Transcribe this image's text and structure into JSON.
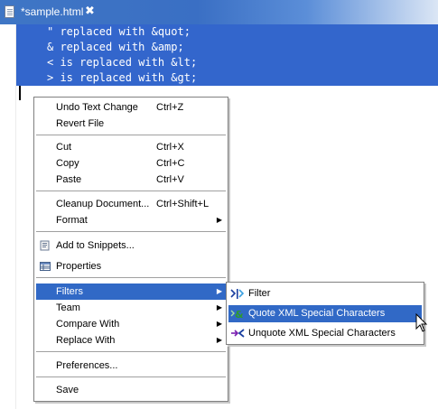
{
  "tab": {
    "title": "*sample.html",
    "close_glyph": "✖"
  },
  "editor": {
    "lines": [
      "\" replaced with &quot;",
      "& replaced with &amp;",
      "< is replaced with &lt;",
      "> is replaced with &gt;"
    ],
    "selection_color": "#3366cc"
  },
  "context_menu": {
    "undo": {
      "label": "Undo Text Change",
      "accel": "Ctrl+Z"
    },
    "revert": {
      "label": "Revert File"
    },
    "cut": {
      "label": "Cut",
      "accel": "Ctrl+X"
    },
    "copy": {
      "label": "Copy",
      "accel": "Ctrl+C"
    },
    "paste": {
      "label": "Paste",
      "accel": "Ctrl+V"
    },
    "cleanup": {
      "label": "Cleanup Document...",
      "accel": "Ctrl+Shift+L"
    },
    "format": {
      "label": "Format"
    },
    "add_snippets": {
      "label": "Add to Snippets..."
    },
    "properties": {
      "label": "Properties"
    },
    "filters": {
      "label": "Filters"
    },
    "team": {
      "label": "Team"
    },
    "compare": {
      "label": "Compare With"
    },
    "replace": {
      "label": "Replace With"
    },
    "preferences": {
      "label": "Preferences..."
    },
    "save": {
      "label": "Save"
    },
    "highlight_color": "#3169c6"
  },
  "filters_submenu": {
    "filter": {
      "label": "Filter",
      "icon": "filter-icon"
    },
    "quote": {
      "label": "Quote XML Special Characters",
      "icon": "quote-xml-icon"
    },
    "unquote": {
      "label": "Unquote XML Special Characters",
      "icon": "unquote-xml-icon"
    }
  }
}
